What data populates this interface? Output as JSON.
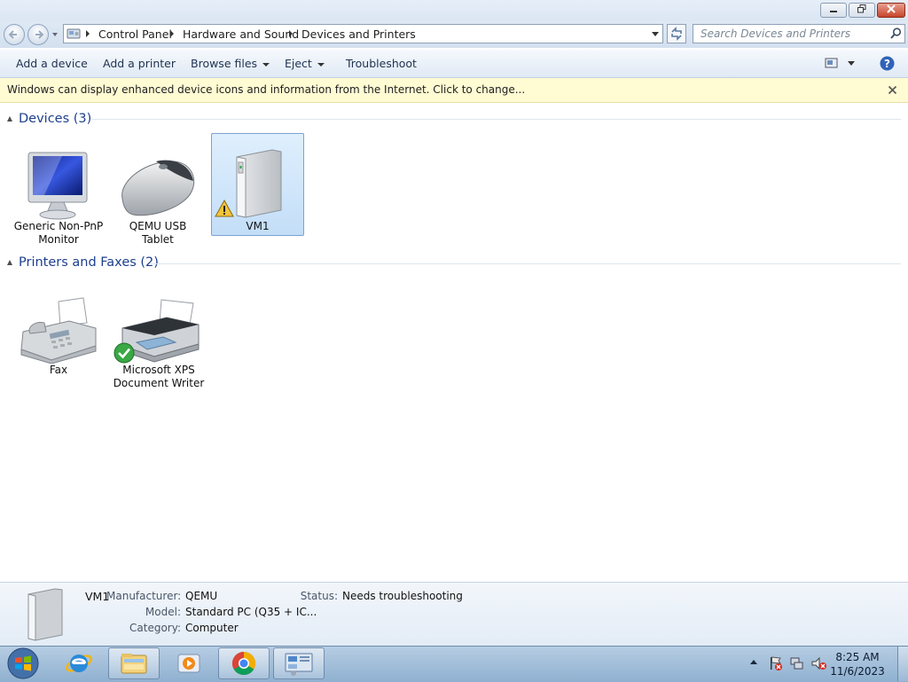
{
  "window": {
    "buttons": {
      "minimize": "minimize",
      "maximize": "restore",
      "close": "close"
    }
  },
  "address": {
    "breadcrumbs": [
      "Control Panel",
      "Hardware and Sound",
      "Devices and Printers"
    ],
    "search_placeholder": "Search Devices and Printers"
  },
  "toolbar": {
    "add_device": "Add a device",
    "add_printer": "Add a printer",
    "browse_files": "Browse files",
    "eject": "Eject",
    "troubleshoot": "Troubleshoot"
  },
  "infobar": {
    "text": "Windows can display enhanced device icons and information from the Internet. Click to change..."
  },
  "groups": {
    "devices": {
      "title": "Devices (3)",
      "items": [
        {
          "label": "Generic Non-PnP Monitor",
          "line1": "Generic Non-PnP",
          "line2": "Monitor",
          "icon": "monitor-icon"
        },
        {
          "label": "QEMU USB Tablet",
          "line1": "QEMU USB",
          "line2": "Tablet",
          "icon": "mouse-icon"
        },
        {
          "label": "VM1",
          "line1": "VM1",
          "line2": "",
          "icon": "computer-icon",
          "badge": "warning-icon",
          "selected": true
        }
      ]
    },
    "printers": {
      "title": "Printers and Faxes (2)",
      "items": [
        {
          "label": "Fax",
          "line1": "Fax",
          "line2": "",
          "icon": "fax-icon"
        },
        {
          "label": "Microsoft XPS Document Writer",
          "line1": "Microsoft XPS",
          "line2": "Document Writer",
          "icon": "printer-icon",
          "badge": "default-check-icon"
        }
      ]
    }
  },
  "details": {
    "name": "VM1",
    "manufacturer_label": "Manufacturer:",
    "manufacturer": "QEMU",
    "model_label": "Model:",
    "model": "Standard PC (Q35 + IC...",
    "category_label": "Category:",
    "category": "Computer",
    "status_label": "Status:",
    "status": "Needs troubleshooting"
  },
  "taskbar": {
    "pinned": [
      "internet-explorer-icon",
      "file-explorer-icon",
      "media-player-icon",
      "chrome-icon",
      "devices-and-printers-icon"
    ],
    "time": "8:25 AM",
    "date": "11/6/2023"
  },
  "colors": {
    "infobar_bg": "#fffbd3",
    "group_header": "#1e3f8f",
    "selection": "#c3def8"
  }
}
